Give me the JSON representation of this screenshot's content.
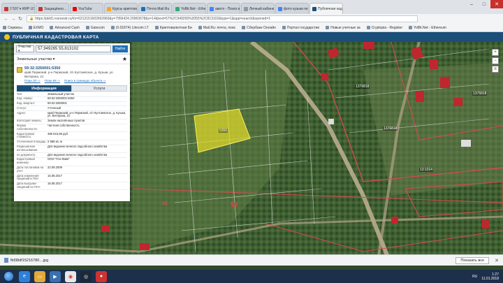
{
  "browser": {
    "tabs": [
      {
        "label": "2 597 ▾ ИИР USD",
        "color": "#c33"
      },
      {
        "label": "Защищённо…",
        "color": "#c33"
      },
      {
        "label": "YouTube",
        "color": "#e00"
      },
      {
        "label": "Курсы криптовалют",
        "color": "#f5a623"
      },
      {
        "label": "Почта Mail.Ru",
        "color": "#1f6fb5"
      },
      {
        "label": "YoBit.Net - Ethereum",
        "color": "#3a7"
      },
      {
        "label": "авито - Поиск в Google",
        "color": "#4285f4"
      },
      {
        "label": "Личный кабинет - Mo",
        "color": "#999"
      },
      {
        "label": "фото кузьки первые",
        "color": "#4285f4"
      },
      {
        "label": "Публичная кадастровая",
        "color": "#1c4e7a",
        "active": true
      }
    ],
    "url": "https://pkk5.rosreestr.ru/#x=6213151602663969&y=7956424.20963678&z=14&text=57%2C949265%2055%2C813102&type=1&app=search&opened=1",
    "bookmarks": [
      "Сервисы",
      "EXMO",
      "Advanced Cash",
      "Gatecoin",
      "(0.01874) Litecoin LT",
      "Криптовалютная Би",
      "Mail.Ru: почта, поис",
      "Сбербанк Онлайн",
      "Портал государстве",
      "Новые учетные за",
      "Cryptopia - Register",
      "YoBit.Net - Ethereum"
    ]
  },
  "map": {
    "header_title": "ПУБЛИЧНАЯ КАДАСТРОВАЯ КАРТА",
    "label_59": "59",
    "label_32": "32",
    "quarter_labels": [
      "1376818",
      "1376818",
      "1376818",
      "13:1014"
    ],
    "plot_label": "5350",
    "copyright": "© НПО «Роскарта» 2016 | НКК © Росреестр 2010-2016"
  },
  "panel": {
    "search_type": "Участки ▾",
    "search_value": "57,949265 55,813102",
    "find_button": "Найти",
    "layer": "Земельные участки ▾",
    "cadastral_number": "59:32:3250001:5350",
    "address_short": "край Пермский, р-н Пермский, с/п Култаевское, д. Кузьки, ул. Ветерана, 21",
    "links": [
      "План ЗУ ⇨",
      "План КК ⇨",
      "Поиск в границах объекта ⇨"
    ],
    "tab_info": "Информация",
    "tab_services": "Услуги",
    "rows": [
      {
        "k": "Тип:",
        "v": "Земельный участок"
      },
      {
        "k": "Кад. номер:",
        "v": "59:32:3250001:5350"
      },
      {
        "k": "Кад. квартал:",
        "v": "59:32:3250001"
      },
      {
        "k": "Статус:",
        "v": "Учтенный"
      },
      {
        "k": "Адрес:",
        "v": "край Пермский, р-н Пермский, с/п Култаевское, д. Кузьки, ул. Ветерана, 21"
      },
      {
        "k": "Категория земель:",
        "v": "Земли населённых пунктов"
      },
      {
        "k": "Форма собственности:",
        "v": "Частная собственность"
      },
      {
        "k": "Кадастровая стоимость:",
        "v": "486 515,95 руб."
      },
      {
        "k": "Уточненная площадь:",
        "v": "2 985 кв. м"
      },
      {
        "k": "Разрешенное использование:",
        "v": "Для ведения личного подсобного хозяйства"
      },
      {
        "k": "по документу:",
        "v": "Для ведения личного подсобного хозяйства"
      },
      {
        "k": "Кадастровый инженер:",
        "v": "ООО \"Гео-Лайн\""
      },
      {
        "k": "Дата постановки на учет:",
        "v": "22.09.2009"
      },
      {
        "k": "Дата изменения сведений в ГКН:",
        "v": "15.08.2017"
      },
      {
        "k": "Дата выгрузки сведений из ГКН:",
        "v": "16.08.2017"
      }
    ]
  },
  "downloads": {
    "file": "fbf38df15216780…jpg",
    "show_all": "Показать все",
    "close": "✕"
  },
  "taskbar": {
    "lang": "RU",
    "time": "1:27",
    "date": "11.01.2018"
  }
}
